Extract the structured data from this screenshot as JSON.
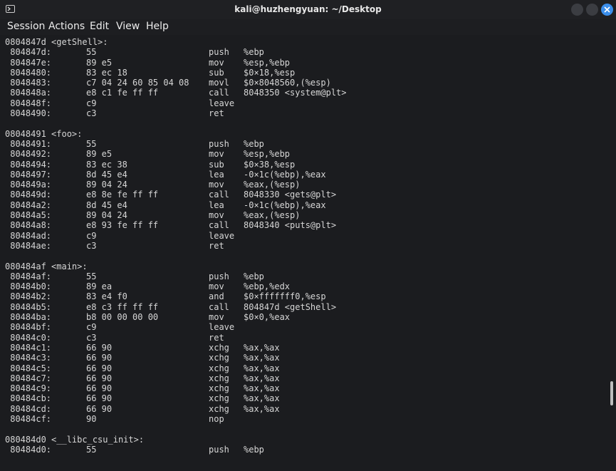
{
  "window": {
    "title": "kali@huzhengyuan: ~/Desktop",
    "close_color": "#3b8eea"
  },
  "menu": [
    "Session",
    "Actions",
    "Edit",
    "View",
    "Help"
  ],
  "lines": [
    {
      "type": "label",
      "text": "0804847d <getShell>:"
    },
    {
      "type": "ins",
      "addr": " 804847d:",
      "bytes": "55",
      "mn": "push",
      "op": "%ebp"
    },
    {
      "type": "ins",
      "addr": " 804847e:",
      "bytes": "89 e5",
      "mn": "mov",
      "op": "%esp,%ebp"
    },
    {
      "type": "ins",
      "addr": " 8048480:",
      "bytes": "83 ec 18",
      "mn": "sub",
      "op": "$0×18,%esp"
    },
    {
      "type": "ins",
      "addr": " 8048483:",
      "bytes": "c7 04 24 60 85 04 08",
      "mn": "movl",
      "op": "$0×8048560,(%esp)"
    },
    {
      "type": "ins",
      "addr": " 804848a:",
      "bytes": "e8 c1 fe ff ff",
      "mn": "call",
      "op": "8048350 <system@plt>"
    },
    {
      "type": "ins",
      "addr": " 804848f:",
      "bytes": "c9",
      "mn": "leave",
      "op": ""
    },
    {
      "type": "ins",
      "addr": " 8048490:",
      "bytes": "c3",
      "mn": "ret",
      "op": ""
    },
    {
      "type": "blank"
    },
    {
      "type": "label",
      "text": "08048491 <foo>:"
    },
    {
      "type": "ins",
      "addr": " 8048491:",
      "bytes": "55",
      "mn": "push",
      "op": "%ebp"
    },
    {
      "type": "ins",
      "addr": " 8048492:",
      "bytes": "89 e5",
      "mn": "mov",
      "op": "%esp,%ebp"
    },
    {
      "type": "ins",
      "addr": " 8048494:",
      "bytes": "83 ec 38",
      "mn": "sub",
      "op": "$0×38,%esp"
    },
    {
      "type": "ins",
      "addr": " 8048497:",
      "bytes": "8d 45 e4",
      "mn": "lea",
      "op": "-0×1c(%ebp),%eax"
    },
    {
      "type": "ins",
      "addr": " 804849a:",
      "bytes": "89 04 24",
      "mn": "mov",
      "op": "%eax,(%esp)"
    },
    {
      "type": "ins",
      "addr": " 804849d:",
      "bytes": "e8 8e fe ff ff",
      "mn": "call",
      "op": "8048330 <gets@plt>"
    },
    {
      "type": "ins",
      "addr": " 80484a2:",
      "bytes": "8d 45 e4",
      "mn": "lea",
      "op": "-0×1c(%ebp),%eax"
    },
    {
      "type": "ins",
      "addr": " 80484a5:",
      "bytes": "89 04 24",
      "mn": "mov",
      "op": "%eax,(%esp)"
    },
    {
      "type": "ins",
      "addr": " 80484a8:",
      "bytes": "e8 93 fe ff ff",
      "mn": "call",
      "op": "8048340 <puts@plt>"
    },
    {
      "type": "ins",
      "addr": " 80484ad:",
      "bytes": "c9",
      "mn": "leave",
      "op": ""
    },
    {
      "type": "ins",
      "addr": " 80484ae:",
      "bytes": "c3",
      "mn": "ret",
      "op": ""
    },
    {
      "type": "blank"
    },
    {
      "type": "label",
      "text": "080484af <main>:"
    },
    {
      "type": "ins",
      "addr": " 80484af:",
      "bytes": "55",
      "mn": "push",
      "op": "%ebp"
    },
    {
      "type": "ins",
      "addr": " 80484b0:",
      "bytes": "89 ea",
      "mn": "mov",
      "op": "%ebp,%edx"
    },
    {
      "type": "ins",
      "addr": " 80484b2:",
      "bytes": "83 e4 f0",
      "mn": "and",
      "op": "$0×fffffff0,%esp"
    },
    {
      "type": "ins",
      "addr": " 80484b5:",
      "bytes": "e8 c3 ff ff ff",
      "mn": "call",
      "op": "804847d <getShell>"
    },
    {
      "type": "ins",
      "addr": " 80484ba:",
      "bytes": "b8 00 00 00 00",
      "mn": "mov",
      "op": "$0×0,%eax"
    },
    {
      "type": "ins",
      "addr": " 80484bf:",
      "bytes": "c9",
      "mn": "leave",
      "op": ""
    },
    {
      "type": "ins",
      "addr": " 80484c0:",
      "bytes": "c3",
      "mn": "ret",
      "op": ""
    },
    {
      "type": "ins",
      "addr": " 80484c1:",
      "bytes": "66 90",
      "mn": "xchg",
      "op": "%ax,%ax"
    },
    {
      "type": "ins",
      "addr": " 80484c3:",
      "bytes": "66 90",
      "mn": "xchg",
      "op": "%ax,%ax"
    },
    {
      "type": "ins",
      "addr": " 80484c5:",
      "bytes": "66 90",
      "mn": "xchg",
      "op": "%ax,%ax"
    },
    {
      "type": "ins",
      "addr": " 80484c7:",
      "bytes": "66 90",
      "mn": "xchg",
      "op": "%ax,%ax"
    },
    {
      "type": "ins",
      "addr": " 80484c9:",
      "bytes": "66 90",
      "mn": "xchg",
      "op": "%ax,%ax"
    },
    {
      "type": "ins",
      "addr": " 80484cb:",
      "bytes": "66 90",
      "mn": "xchg",
      "op": "%ax,%ax"
    },
    {
      "type": "ins",
      "addr": " 80484cd:",
      "bytes": "66 90",
      "mn": "xchg",
      "op": "%ax,%ax"
    },
    {
      "type": "ins",
      "addr": " 80484cf:",
      "bytes": "90",
      "mn": "nop",
      "op": ""
    },
    {
      "type": "blank"
    },
    {
      "type": "label",
      "text": "080484d0 <__libc_csu_init>:"
    },
    {
      "type": "ins",
      "addr": " 80484d0:",
      "bytes": "55",
      "mn": "push",
      "op": "%ebp"
    }
  ]
}
